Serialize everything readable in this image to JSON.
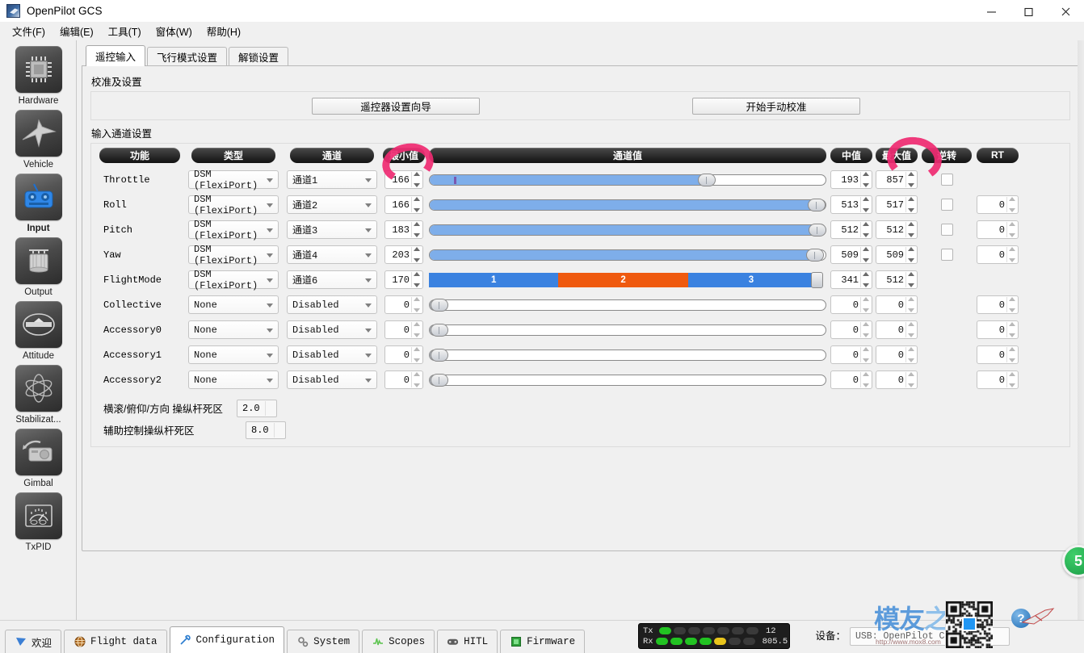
{
  "window": {
    "title": "OpenPilot GCS",
    "icon": "app-icon",
    "minimize": "—",
    "maximize": "□",
    "close": "✕"
  },
  "menubar": [
    {
      "label": "文件(F)",
      "name": "menu-file"
    },
    {
      "label": "编辑(E)",
      "name": "menu-edit"
    },
    {
      "label": "工具(T)",
      "name": "menu-tools"
    },
    {
      "label": "窗体(W)",
      "name": "menu-window"
    },
    {
      "label": "帮助(H)",
      "name": "menu-help"
    }
  ],
  "sidebar": {
    "items": [
      {
        "label": "Hardware",
        "icon": "chip-icon",
        "active": false
      },
      {
        "label": "Vehicle",
        "icon": "airplane-icon",
        "active": false
      },
      {
        "label": "Input",
        "icon": "transmitter-icon",
        "active": true
      },
      {
        "label": "Output",
        "icon": "motor-icon",
        "active": false
      },
      {
        "label": "Attitude",
        "icon": "level-icon",
        "active": false
      },
      {
        "label": "Stabilizat...",
        "icon": "gyroscope-icon",
        "active": false
      },
      {
        "label": "Gimbal",
        "icon": "camera-icon",
        "active": false
      },
      {
        "label": "TxPID",
        "icon": "gauge-icon",
        "active": false
      }
    ]
  },
  "tabs": [
    {
      "label": "遥控输入",
      "selected": true
    },
    {
      "label": "飞行模式设置",
      "selected": false
    },
    {
      "label": "解锁设置",
      "selected": false
    }
  ],
  "calibration": {
    "group_label": "校准及设置",
    "wizard_button": "遥控器设置向导",
    "manual_button": "开始手动校准"
  },
  "channels": {
    "group_label": "输入通道设置",
    "headers": {
      "function": "功能",
      "type": "类型",
      "channel": "通道",
      "min": "最小值",
      "value": "通道值",
      "mid": "中值",
      "max": "最大值",
      "reverse": "逆转",
      "rt": "RT"
    },
    "rows": [
      {
        "function": "Throttle",
        "type": "DSM (FlexiPort)",
        "channel": "通道1",
        "min": "166",
        "mid": "193",
        "max": "857",
        "reverse": false,
        "rt": null,
        "has_checkbox": true,
        "slider": {
          "kind": "bar",
          "fill_pct": 70,
          "tick_pct": 6,
          "off": false
        }
      },
      {
        "function": "Roll",
        "type": "DSM (FlexiPort)",
        "channel": "通道2",
        "min": "166",
        "mid": "513",
        "max": "517",
        "reverse": false,
        "rt": "0",
        "has_checkbox": true,
        "slider": {
          "kind": "bar",
          "fill_pct": 97.5,
          "tick_pct": null,
          "off": false
        }
      },
      {
        "function": "Pitch",
        "type": "DSM (FlexiPort)",
        "channel": "通道3",
        "min": "183",
        "mid": "512",
        "max": "512",
        "reverse": false,
        "rt": "0",
        "has_checkbox": true,
        "slider": {
          "kind": "bar",
          "fill_pct": 97.8,
          "tick_pct": null,
          "off": false
        }
      },
      {
        "function": "Yaw",
        "type": "DSM (FlexiPort)",
        "channel": "通道4",
        "min": "203",
        "mid": "509",
        "max": "509",
        "reverse": false,
        "rt": "0",
        "has_checkbox": true,
        "slider": {
          "kind": "bar",
          "fill_pct": 97.2,
          "tick_pct": null,
          "off": false
        }
      },
      {
        "function": "FlightMode",
        "type": "DSM (FlexiPort)",
        "channel": "通道6",
        "min": "170",
        "mid": "341",
        "max": "512",
        "reverse": null,
        "rt": null,
        "has_checkbox": false,
        "slider": {
          "kind": "flightmode"
        }
      },
      {
        "function": "Collective",
        "type": "None",
        "channel": "Disabled",
        "min": "0",
        "mid": "0",
        "max": "0",
        "reverse": null,
        "rt": "0",
        "has_checkbox": false,
        "slider": {
          "kind": "bar",
          "fill_pct": 3,
          "tick_pct": null,
          "off": true
        }
      },
      {
        "function": "Accessory0",
        "type": "None",
        "channel": "Disabled",
        "min": "0",
        "mid": "0",
        "max": "0",
        "reverse": null,
        "rt": "0",
        "has_checkbox": false,
        "slider": {
          "kind": "bar",
          "fill_pct": 3,
          "tick_pct": null,
          "off": true
        }
      },
      {
        "function": "Accessory1",
        "type": "None",
        "channel": "Disabled",
        "min": "0",
        "mid": "0",
        "max": "0",
        "reverse": null,
        "rt": "0",
        "has_checkbox": false,
        "slider": {
          "kind": "bar",
          "fill_pct": 3,
          "tick_pct": null,
          "off": true
        }
      },
      {
        "function": "Accessory2",
        "type": "None",
        "channel": "Disabled",
        "min": "0",
        "mid": "0",
        "max": "0",
        "reverse": null,
        "rt": "0",
        "has_checkbox": false,
        "slider": {
          "kind": "bar",
          "fill_pct": 3,
          "tick_pct": null,
          "off": true
        }
      }
    ],
    "flightmode_segments": [
      {
        "label": "1",
        "start_pct": 0,
        "width_pct": 32.6,
        "color": "#3b82e0"
      },
      {
        "label": "2",
        "start_pct": 32.6,
        "width_pct": 32.6,
        "color": "#ef5a0f"
      },
      {
        "label": "3",
        "start_pct": 65.2,
        "width_pct": 31.8,
        "color": "#3b82e0"
      }
    ],
    "flightmode_knob_pct": 97
  },
  "deadband": [
    {
      "label": "横滚/俯仰/方向 操纵杆死区",
      "value": "2.0"
    },
    {
      "label": "辅助控制操纵杆死区",
      "value": "8.0"
    }
  ],
  "bottom_tabs": [
    {
      "label": "欢迎",
      "icon": "welcome-icon",
      "selected": false
    },
    {
      "label": "Flight data",
      "icon": "globe-icon",
      "selected": false
    },
    {
      "label": "Configuration",
      "icon": "wrench-icon",
      "selected": true
    },
    {
      "label": "System",
      "icon": "gears-icon",
      "selected": false
    },
    {
      "label": "Scopes",
      "icon": "waveform-icon",
      "selected": false
    },
    {
      "label": "HITL",
      "icon": "gamepad-icon",
      "selected": false
    },
    {
      "label": "Firmware",
      "icon": "chip-green-icon",
      "selected": false
    }
  ],
  "status": {
    "tx_label": "Tx",
    "rx_label": "Rx",
    "tx_value": "12",
    "rx_value": "805.5",
    "tx_leds": [
      "g",
      "off",
      "off",
      "off",
      "off",
      "off",
      "off"
    ],
    "rx_leds": [
      "g",
      "g",
      "g",
      "g",
      "y",
      "off",
      "off"
    ],
    "device_label": "设备：",
    "device_value": "USB: OpenPilot Contro",
    "help_icon": "?",
    "badge_value": "5"
  },
  "watermark": {
    "text_dark": "模友",
    "text_light": "之吧",
    "url": "http://www.mox8.com",
    "qr": "qr-code-icon"
  },
  "colors": {
    "accent_blue": "#3b82e0",
    "slider_fill": "#7eaeea",
    "flightmode_orange": "#ef5a0f",
    "annotation_pink": "#ef2b72",
    "led_green": "#22c322",
    "led_yellow": "#e8c41c",
    "badge_green": "#1b9b47"
  }
}
